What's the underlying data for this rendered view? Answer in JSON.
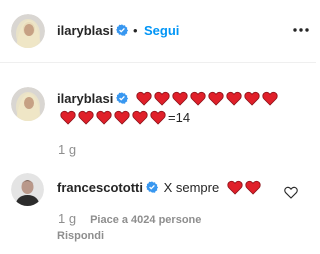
{
  "header": {
    "username": "ilaryblasi",
    "separator": "•",
    "follow_label": "Segui",
    "more_icon": "more-horizontal-icon"
  },
  "caption": {
    "username": "ilaryblasi",
    "heart_count_line1": 8,
    "heart_count_line2": 6,
    "suffix": "=14",
    "time": "1 g"
  },
  "comment": {
    "username": "francescototti",
    "text": "X sempre",
    "heart_count": 2,
    "time": "1 g",
    "likes": "Piace a 4024 persone",
    "reply_label": "Rispondi"
  },
  "colors": {
    "heart": "#e0202a",
    "verified": "#3897f0",
    "link": "#0095f6",
    "muted": "#8e8e8e"
  }
}
